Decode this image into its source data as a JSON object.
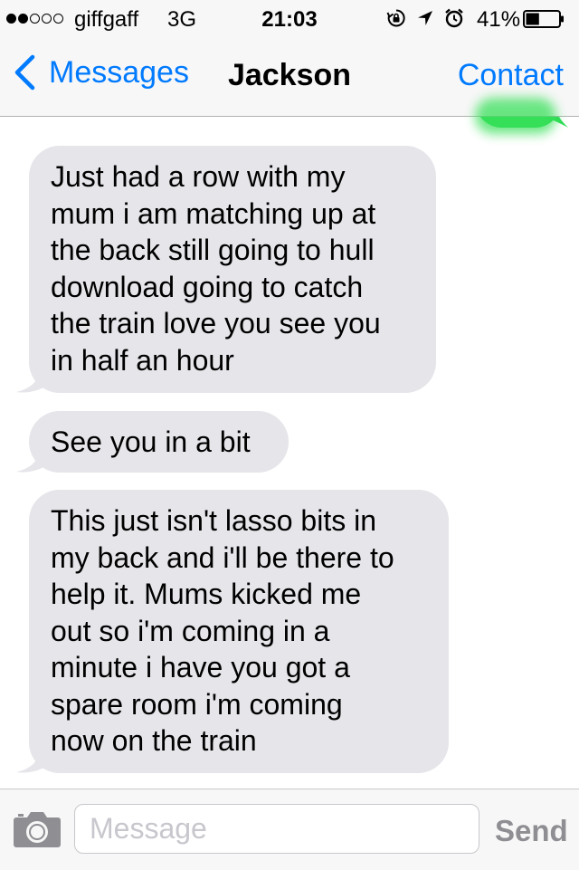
{
  "status_bar": {
    "carrier": "giffgaff",
    "network": "3G",
    "time": "21:03",
    "battery_percent": "41%",
    "battery_level": 0.41,
    "signal_bars_filled": 2,
    "signal_bars_total": 5,
    "icons": [
      "rotation-lock-icon",
      "location-icon",
      "alarm-icon",
      "battery-icon"
    ]
  },
  "nav": {
    "back_label": "Messages",
    "title": "Jackson",
    "contact_label": "Contact",
    "back_icon": "chevron-left-icon"
  },
  "messages": [
    {
      "direction": "incoming",
      "text": "Just had a row with my\nmum i am matching up at\nthe back still going to hull\ndownload going to catch\nthe train love you see you\nin half an hour"
    },
    {
      "direction": "incoming",
      "text": "See you in a bit"
    },
    {
      "direction": "incoming",
      "text": "This just isn't lasso bits in\nmy back and i'll be there to\nhelp it. Mums kicked me\nout so i'm coming in a\nminute i have you got a\nspare room i'm coming\nnow on the train"
    }
  ],
  "input": {
    "placeholder": "Message",
    "value": "",
    "send_label": "Send",
    "camera_icon": "camera-icon"
  },
  "colors": {
    "accent": "#007aff",
    "incoming_bubble": "#e5e5ea",
    "outgoing_bubble": "#2cdc54",
    "send_disabled": "#8e8e93"
  }
}
